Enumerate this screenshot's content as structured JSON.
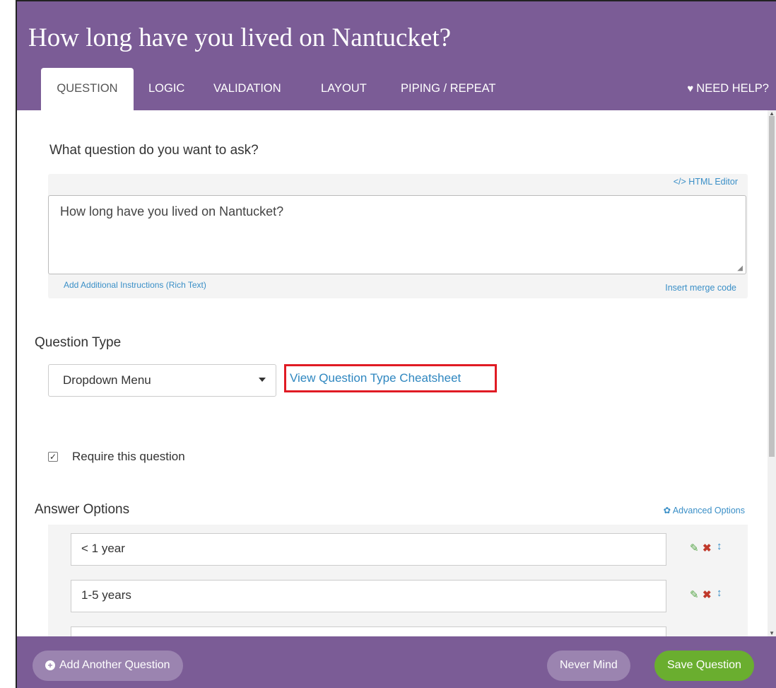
{
  "header": {
    "title": "How long have you lived on Nantucket?",
    "tabs": [
      "QUESTION",
      "LOGIC",
      "VALIDATION",
      "LAYOUT",
      "PIPING / REPEAT"
    ],
    "help_label": "NEED HELP?",
    "help_icon": "heart-icon"
  },
  "question": {
    "prompt": "What question do you want to ask?",
    "html_editor_label": "</> HTML Editor",
    "text_value": "How long have you lived on Nantucket?",
    "add_instructions_label": "Add Additional Instructions (Rich Text)",
    "insert_merge_label": "Insert merge code"
  },
  "question_type": {
    "heading": "Question Type",
    "selected": "Dropdown Menu",
    "cheatsheet_link": "View Question Type Cheatsheet"
  },
  "require": {
    "label": "Require this question",
    "checked": true
  },
  "answer_options": {
    "heading": "Answer Options",
    "advanced_label": "Advanced Options",
    "items": [
      "< 1 year",
      "1-5 years"
    ]
  },
  "footer": {
    "add_label": "Add Another Question",
    "never_mind_label": "Never Mind",
    "save_label": "Save Question"
  },
  "colors": {
    "header_purple": "#7b5c96",
    "link_blue": "#3a8fc7",
    "save_green": "#6aae2f",
    "highlight_red": "#e01b24"
  }
}
